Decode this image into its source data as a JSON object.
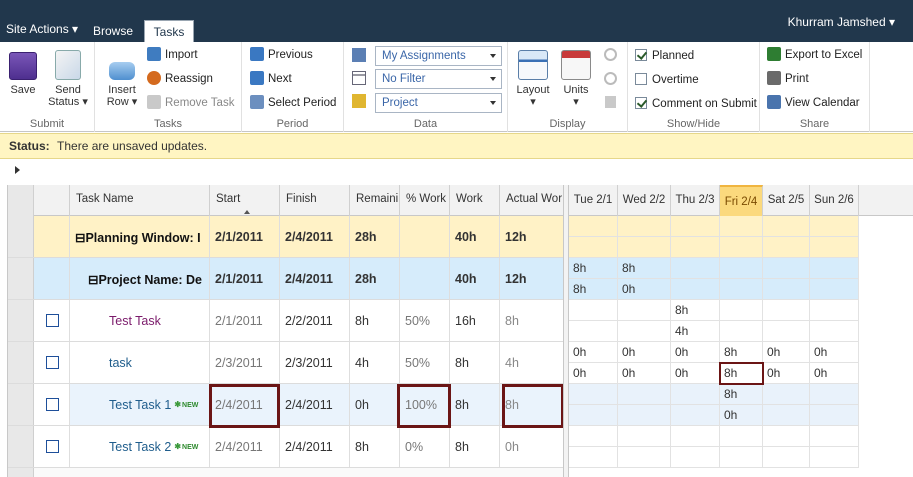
{
  "topbar": {
    "site_actions": "Site Actions ▾",
    "tabs": [
      "Browse",
      "Tasks"
    ],
    "user": "Khurram Jamshed ▾"
  },
  "ribbon": {
    "submit": {
      "label": "Submit",
      "save": "Save",
      "send_status_1": "Send",
      "send_status_2": "Status ▾"
    },
    "tasks": {
      "label": "Tasks",
      "insert_row_1": "Insert",
      "insert_row_2": "Row ▾",
      "import": "Import",
      "reassign": "Reassign",
      "remove_task": "Remove Task"
    },
    "period": {
      "label": "Period",
      "previous": "Previous",
      "next": "Next",
      "select_period": "Select Period"
    },
    "data": {
      "label": "Data",
      "assignments": "My Assignments",
      "filter": "No Filter",
      "group": "Project"
    },
    "display": {
      "label": "Display",
      "layout": "Layout",
      "units": "Units"
    },
    "showhide": {
      "label": "Show/Hide",
      "planned": "Planned",
      "planned_checked": true,
      "overtime": "Overtime",
      "overtime_checked": false,
      "comment": "Comment on Submit",
      "comment_checked": true
    },
    "share": {
      "label": "Share",
      "export_excel": "Export to Excel",
      "print": "Print",
      "view_calendar": "View Calendar"
    }
  },
  "status": {
    "label": "Status:",
    "message": "There are unsaved updates."
  },
  "grid": {
    "columns": [
      "Task Name",
      "Start",
      "Finish",
      "Remaini",
      "% Work",
      "Work",
      "Actual Wor"
    ],
    "rows": [
      {
        "type": "summary1",
        "name": "⊟Planning Window: I",
        "start": "2/1/2011",
        "finish": "2/4/2011",
        "remaining": "28h",
        "pct": "",
        "work": "40h",
        "actual": "12h"
      },
      {
        "type": "summary2",
        "name": "⊟Project Name: De",
        "start": "2/1/2011",
        "finish": "2/4/2011",
        "remaining": "28h",
        "pct": "",
        "work": "40h",
        "actual": "12h"
      },
      {
        "type": "task",
        "name": "Test Task",
        "new": "",
        "start": "2/1/2011",
        "finish": "2/2/2011",
        "remaining": "8h",
        "pct": "50%",
        "work": "16h",
        "actual": "8h"
      },
      {
        "type": "task",
        "name": "task",
        "new": "",
        "start": "2/3/2011",
        "finish": "2/3/2011",
        "remaining": "4h",
        "pct": "50%",
        "work": "8h",
        "actual": "4h"
      },
      {
        "type": "task-selected",
        "name": "Test Task 1",
        "new": "NEW",
        "start": "2/4/2011",
        "finish": "2/4/2011",
        "remaining": "0h",
        "pct": "100%",
        "work": "8h",
        "actual": "8h"
      },
      {
        "type": "task",
        "name": "Test Task 2",
        "new": "NEW",
        "start": "2/4/2011",
        "finish": "2/4/2011",
        "remaining": "8h",
        "pct": "0%",
        "work": "8h",
        "actual": "0h"
      }
    ]
  },
  "timeline": {
    "days": [
      "Tue 2/1",
      "Wed 2/2",
      "Thu 2/3",
      "Fri 2/4",
      "Sat 2/5",
      "Sun 2/6"
    ],
    "today_index": 3,
    "rows": [
      [
        "",
        "",
        "",
        "",
        "",
        ""
      ],
      [
        "",
        "",
        "",
        "",
        "",
        ""
      ],
      [
        "8h",
        "8h",
        "",
        "",
        "",
        ""
      ],
      [
        "8h",
        "0h",
        "",
        "",
        "",
        ""
      ],
      [
        "",
        "",
        "8h",
        "",
        "",
        ""
      ],
      [
        "",
        "",
        "4h",
        "",
        "",
        ""
      ],
      [
        "0h",
        "0h",
        "0h",
        "8h",
        "0h",
        "0h"
      ],
      [
        "0h",
        "0h",
        "0h",
        "8h",
        "0h",
        "0h"
      ],
      [
        "",
        "",
        "",
        "8h",
        "",
        ""
      ],
      [
        "",
        "",
        "",
        "0h",
        "",
        ""
      ]
    ]
  },
  "colors": {
    "topbar": "#21374c",
    "status_bg": "#fff5c2",
    "summary1": "#fff2c6",
    "summary2": "#d6ecfb",
    "highlight": "#6b1515",
    "link": "#1f5d8c"
  }
}
